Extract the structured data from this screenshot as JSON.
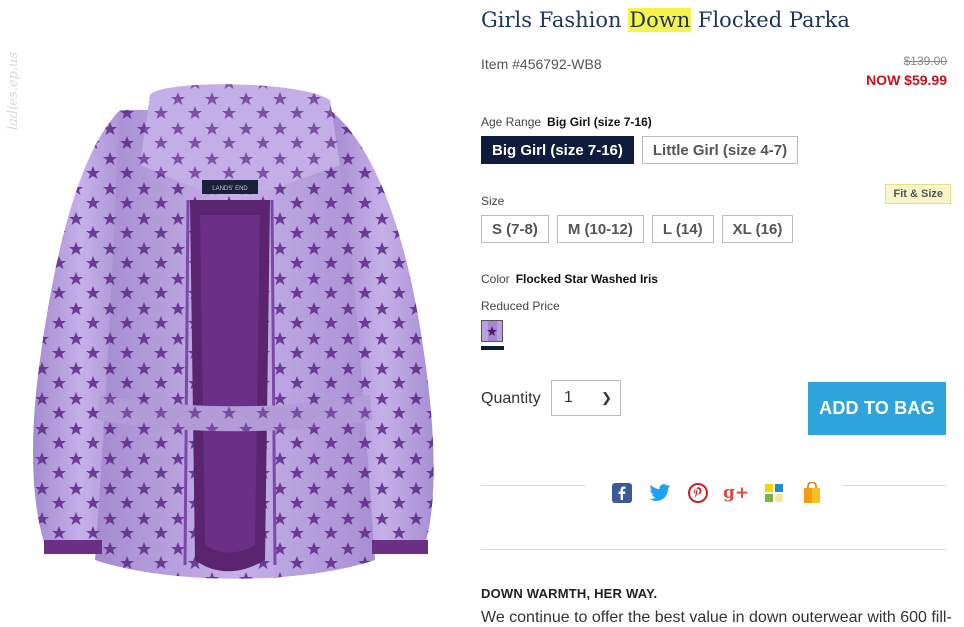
{
  "watermark": "ladies.ep.us",
  "product": {
    "title_before": "Girls Fashion ",
    "title_highlight": "Down",
    "title_after": " Flocked Parka",
    "item_number": "Item #456792-WB8",
    "price_original": "$139.00",
    "price_now": "NOW $59.99",
    "garment_label": "LANDS' END"
  },
  "age_range": {
    "label": "Age Range",
    "selected": "Big Girl (size 7-16)",
    "options": [
      "Big Girl (size 7-16)",
      "Little Girl (size 4-7)"
    ]
  },
  "size": {
    "label": "Size",
    "fit_link": "Fit & Size",
    "options": [
      "S (7-8)",
      "M (10-12)",
      "L (14)",
      "XL (16)"
    ]
  },
  "color": {
    "label": "Color",
    "selected": "Flocked Star Washed Iris",
    "group_label": "Reduced Price",
    "swatch_color": "#b9a0df"
  },
  "quantity": {
    "label": "Quantity",
    "value": "1"
  },
  "add_to_bag": "ADD TO BAG",
  "social_icons": [
    "facebook-icon",
    "twitter-icon",
    "pinterest-icon",
    "google-plus-icon",
    "tile-share-icon",
    "shopping-bag-share-icon"
  ],
  "description": {
    "heading": "DOWN WARMTH, HER WAY.",
    "text": "We continue to offer the best value in down outerwear with 600 fill-"
  },
  "colors": {
    "accent": "#2ea3dc",
    "navy": "#0d1b3d",
    "sale_red": "#c1121f",
    "jacket": "#b9a0df"
  }
}
